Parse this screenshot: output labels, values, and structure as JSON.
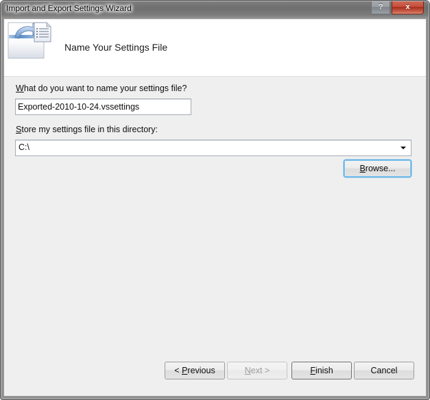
{
  "window": {
    "title": "Import and Export Settings Wizard",
    "help_button_label": "?",
    "close_button_label": "x",
    "help_icon": "question-mark-icon",
    "close_icon": "close-x-icon"
  },
  "header": {
    "title": "Name Your Settings File",
    "icon": "export-settings-document-icon"
  },
  "form": {
    "filename_label_accel": "W",
    "filename_label_rest": "hat do you want to name your settings file?",
    "filename_value": "Exported-2010-10-24.vssettings",
    "filename_placeholder": "",
    "directory_label_accel": "S",
    "directory_label_rest": "tore my settings file in this directory:",
    "directory_value": "C:\\",
    "directory_arrow_icon": "chevron-down-icon",
    "browse_accel": "B",
    "browse_rest": "rowse..."
  },
  "footer": {
    "previous_prefix": "< ",
    "previous_accel": "P",
    "previous_rest": "revious",
    "next_accel": "N",
    "next_rest": "ext >",
    "next_disabled": true,
    "finish_accel": "F",
    "finish_rest": "inish",
    "cancel_label": "Cancel"
  },
  "colors": {
    "close_button": "#c7503c",
    "focus_border": "#3c9ade",
    "client_background": "#efefef",
    "header_background": "#ffffff"
  }
}
